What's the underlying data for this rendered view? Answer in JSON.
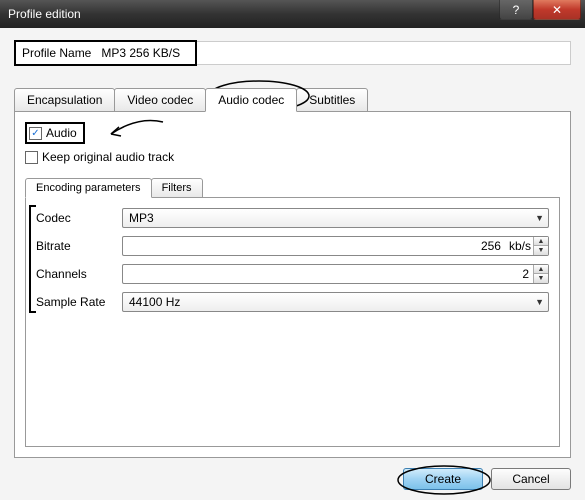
{
  "window": {
    "title": "Profile edition",
    "help_glyph": "?",
    "close_glyph": "✕"
  },
  "profile": {
    "label": "Profile Name",
    "value": "MP3 256 KB/S"
  },
  "main_tabs": {
    "encapsulation": "Encapsulation",
    "video": "Video codec",
    "audio": "Audio codec",
    "subtitles": "Subtitles"
  },
  "audio_panel": {
    "audio_checkbox_label": "Audio",
    "audio_checked_glyph": "✓",
    "keep_original_label": "Keep original audio track"
  },
  "sub_tabs": {
    "encoding": "Encoding parameters",
    "filters": "Filters"
  },
  "fields": {
    "codec": {
      "label": "Codec",
      "value": "MP3"
    },
    "bitrate": {
      "label": "Bitrate",
      "value": "256",
      "unit": "kb/s"
    },
    "channels": {
      "label": "Channels",
      "value": "2"
    },
    "sample_rate": {
      "label": "Sample Rate",
      "value": "44100 Hz"
    }
  },
  "footer": {
    "create": "Create",
    "cancel": "Cancel"
  }
}
